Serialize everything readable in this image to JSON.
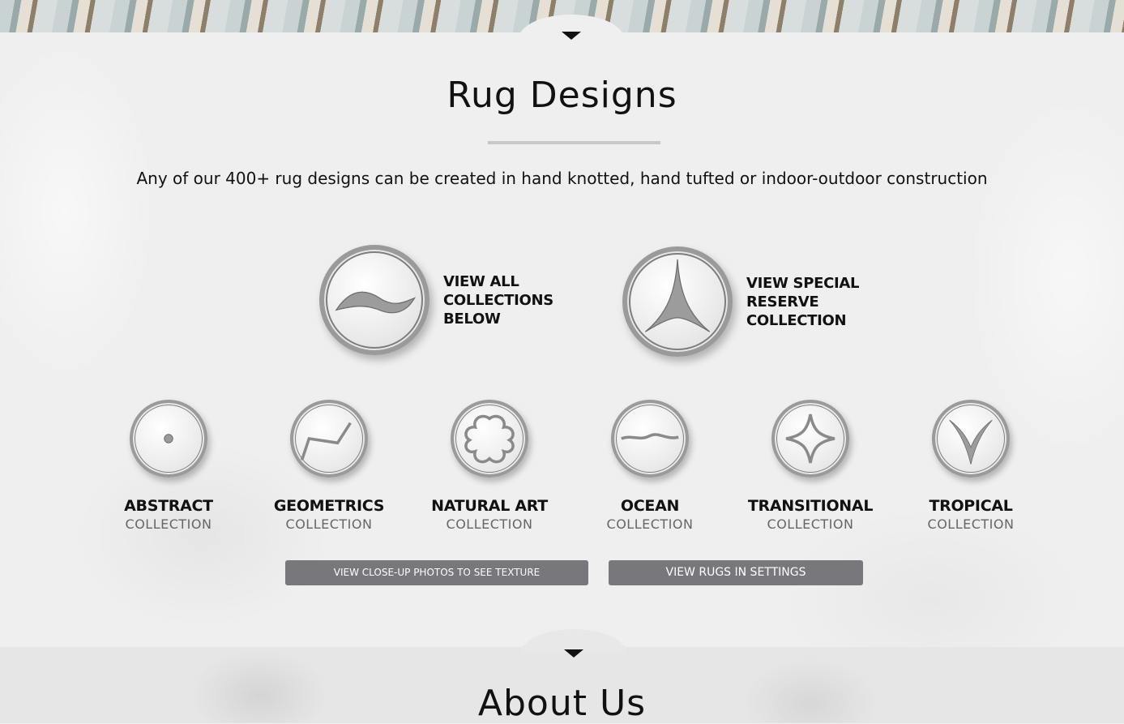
{
  "section_title": "Rug Designs",
  "subtitle": "Any of our 400+ rug designs can be created in hand knotted, hand tufted or indoor-outdoor construction",
  "features": [
    {
      "lines": [
        "VIEW ALL",
        "COLLECTIONS",
        "BELOW"
      ],
      "icon": "wave-icon"
    },
    {
      "lines": [
        "VIEW SPECIAL",
        "RESERVE",
        "COLLECTION"
      ],
      "icon": "star-point-icon"
    }
  ],
  "collections": [
    {
      "name": "ABSTRACT",
      "sub": "COLLECTION",
      "icon": "dot-icon"
    },
    {
      "name": "GEOMETRICS",
      "sub": "COLLECTION",
      "icon": "zigzag-icon"
    },
    {
      "name": "NATURAL ART",
      "sub": "COLLECTION",
      "icon": "quatrefoil-icon"
    },
    {
      "name": "OCEAN",
      "sub": "COLLECTION",
      "icon": "wave-line-icon"
    },
    {
      "name": "TRANSITIONAL",
      "sub": "COLLECTION",
      "icon": "four-point-star-icon"
    },
    {
      "name": "TROPICAL",
      "sub": "COLLECTION",
      "icon": "leaf-v-icon"
    }
  ],
  "buttons": {
    "photos": "VIEW CLOSE-UP PHOTOS TO SEE TEXTURE",
    "settings": "VIEW RUGS IN SETTINGS"
  },
  "next_section_title": "About Us"
}
